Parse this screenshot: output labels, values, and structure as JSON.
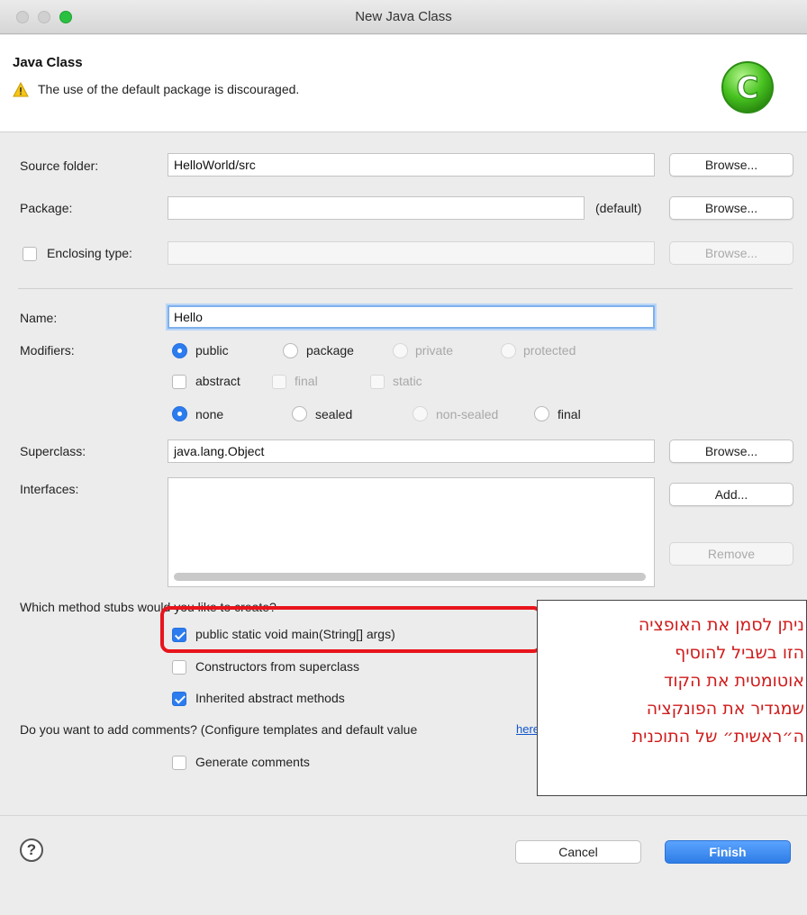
{
  "window": {
    "title": "New Java Class"
  },
  "header": {
    "title": "Java Class",
    "warning": "The use of the default package is discouraged.",
    "logo_letter": "C",
    "logo_color": "#46c11f"
  },
  "form": {
    "source_folder": {
      "label": "Source folder:",
      "value": "HelloWorld/src",
      "button": "Browse..."
    },
    "package": {
      "label": "Package:",
      "value": "",
      "suffix": "(default)",
      "button": "Browse..."
    },
    "enclosing_type": {
      "label": "Enclosing type:",
      "value": "",
      "button": "Browse...",
      "checked": false
    },
    "name": {
      "label": "Name:",
      "value": "Hello"
    },
    "modifiers": {
      "label": "Modifiers:",
      "access": [
        "public",
        "package",
        "private",
        "protected"
      ],
      "access_selected": "public",
      "flags": [
        "abstract",
        "final",
        "static"
      ],
      "sealing": [
        "none",
        "sealed",
        "non-sealed",
        "final"
      ],
      "sealing_selected": "none"
    },
    "superclass": {
      "label": "Superclass:",
      "value": "java.lang.Object",
      "button": "Browse..."
    },
    "interfaces": {
      "label": "Interfaces:",
      "add_button": "Add...",
      "remove_button": "Remove"
    }
  },
  "stubs": {
    "question": "Which method stubs would you like to create?",
    "items": [
      {
        "label": "public static void main(String[] args)",
        "checked": true
      },
      {
        "label": "Constructors from superclass",
        "checked": false
      },
      {
        "label": "Inherited abstract methods",
        "checked": true
      }
    ]
  },
  "comments": {
    "question": "Do you want to add comments? (Configure templates and default value",
    "link": "here",
    "generate_label": "Generate comments",
    "checked": false
  },
  "annotation": {
    "lines": [
      "ניתן לסמן את האופציה",
      "הזו בשביל להוסיף",
      "אוטומטית את הקוד",
      "שמגדיר את הפונקציה",
      "ה״ראשית״ של התוכנית"
    ],
    "color": "#d01b1b"
  },
  "footer": {
    "help": "?",
    "cancel": "Cancel",
    "finish": "Finish"
  }
}
